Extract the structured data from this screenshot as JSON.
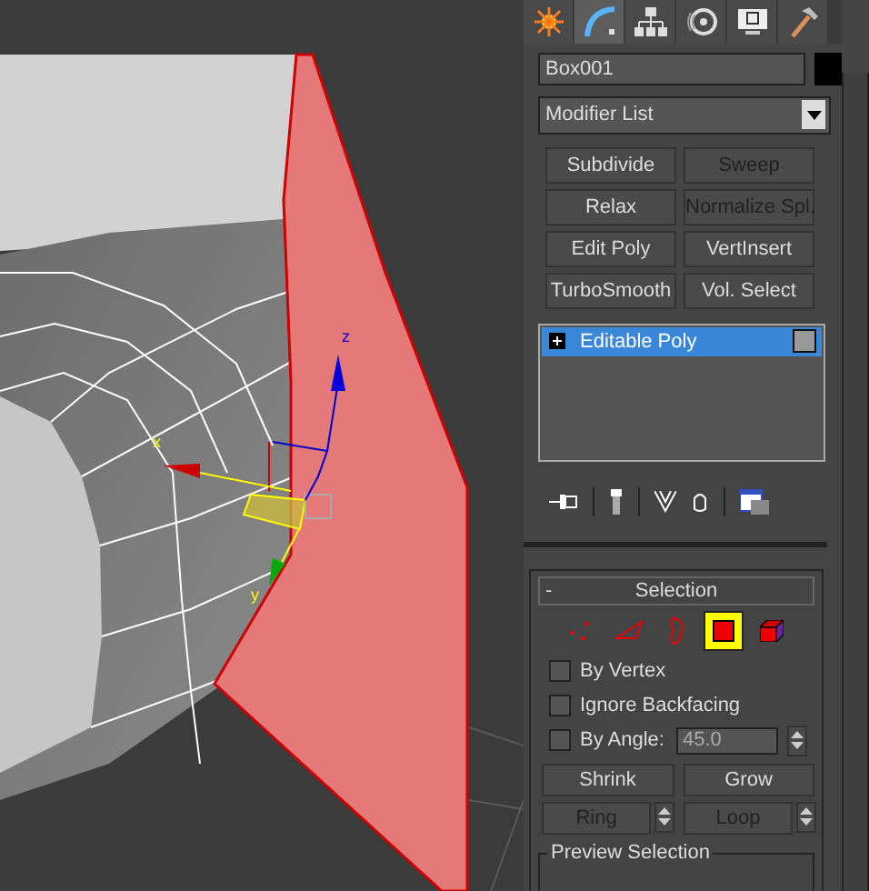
{
  "viewport": {
    "gizmo_labels": [
      "x",
      "y",
      "z"
    ]
  },
  "command_tabs": [
    {
      "kind": "create",
      "selected": false
    },
    {
      "kind": "modify",
      "selected": true
    },
    {
      "kind": "hierarchy",
      "selected": false
    },
    {
      "kind": "motion",
      "selected": false
    },
    {
      "kind": "display",
      "selected": false
    },
    {
      "kind": "utilities",
      "selected": false
    }
  ],
  "object_name": "Box001",
  "modifier_list": "Modifier List",
  "modifier_buttons": [
    {
      "label": "Subdivide",
      "disabled": false
    },
    {
      "label": "Sweep",
      "disabled": true
    },
    {
      "label": "Relax",
      "disabled": false
    },
    {
      "label": "Normalize Spl.",
      "disabled": true
    },
    {
      "label": "Edit Poly",
      "disabled": false
    },
    {
      "label": "VertInsert",
      "disabled": false
    },
    {
      "label": "TurboSmooth",
      "disabled": false
    },
    {
      "label": "Vol. Select",
      "disabled": false
    }
  ],
  "modifier_stack": [
    {
      "label": "Editable Poly",
      "selected": true,
      "expanded": false
    }
  ],
  "selection_rollout": {
    "toggle": "-",
    "title": "Selection",
    "levels": [
      {
        "kind": "vertex",
        "selected": false
      },
      {
        "kind": "edge",
        "selected": false
      },
      {
        "kind": "border",
        "selected": false
      },
      {
        "kind": "polygon",
        "selected": true
      },
      {
        "kind": "element",
        "selected": false
      }
    ],
    "options": [
      {
        "label": "By Vertex",
        "checked": false
      },
      {
        "label": "Ignore Backfacing",
        "checked": false
      },
      {
        "label": "By Angle:",
        "checked": false,
        "value": "45.0"
      }
    ],
    "buttons": [
      "Shrink",
      "Grow"
    ],
    "spinner_buttons": [
      "Ring",
      "Loop"
    ],
    "group_title": "Preview Selection"
  }
}
